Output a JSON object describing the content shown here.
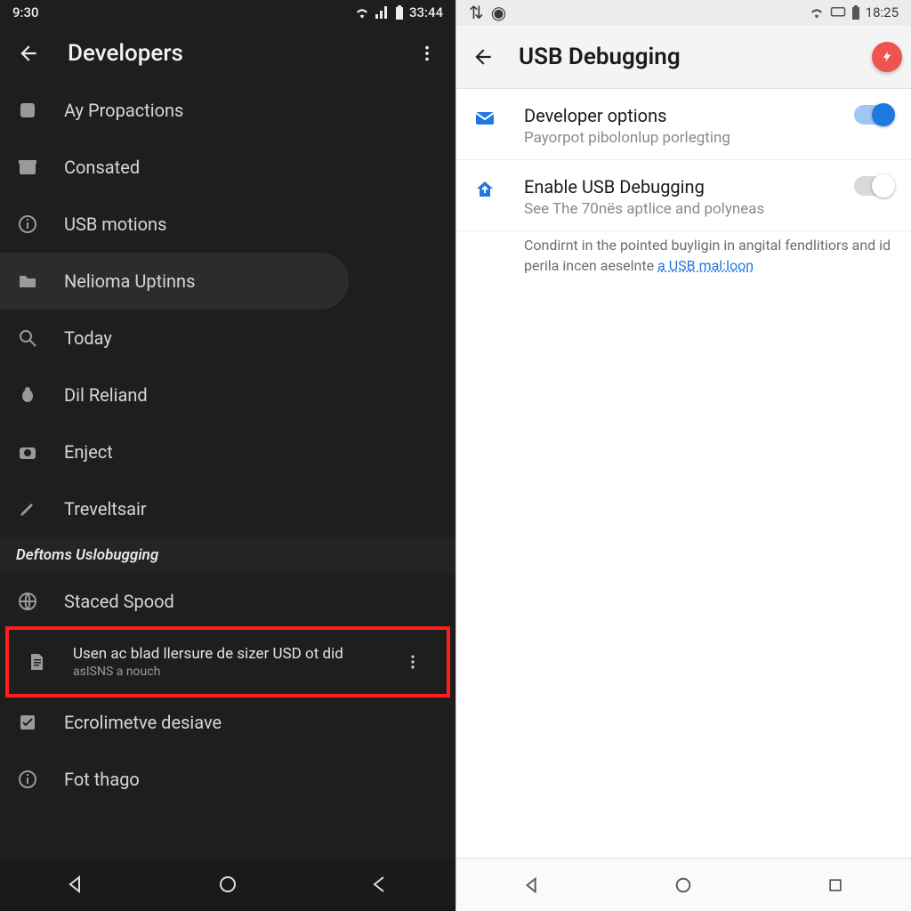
{
  "left": {
    "status": {
      "time": "9:30",
      "extra": "33:44"
    },
    "appbar": {
      "title": "Developers"
    },
    "items_top": [
      {
        "icon": "square-icon",
        "label": "Ay Propactions"
      },
      {
        "icon": "archive-icon",
        "label": "Consated"
      },
      {
        "icon": "info-icon",
        "label": "USB motions"
      },
      {
        "icon": "folder-icon",
        "label": "Nelioma Uptinns",
        "selected": true
      },
      {
        "icon": "search-icon",
        "label": "Today"
      },
      {
        "icon": "bug-icon",
        "label": "Dil Reliand"
      },
      {
        "icon": "camera-icon",
        "label": "Enject"
      },
      {
        "icon": "edit-icon",
        "label": "Treveltsair"
      }
    ],
    "section_header": "Deftoms Uslobugging",
    "items_bottom": [
      {
        "icon": "globe-icon",
        "label": "Staced Spood"
      },
      {
        "icon": "document-icon",
        "label": "Usen ac blad llersure de sizer USD ot did",
        "sub": "asISNS a nouch",
        "highlighted": true,
        "trailing_overflow": true
      },
      {
        "icon": "checkbox-icon",
        "label": "Ecrolimetve desiave"
      },
      {
        "icon": "info-icon",
        "label": "Fot thago"
      }
    ]
  },
  "right": {
    "status": {
      "time": "18:25"
    },
    "appbar": {
      "title": "USB Debugging"
    },
    "settings": [
      {
        "icon": "mail-icon",
        "title": "Developer options",
        "subtitle": "Payorpot pibolonlup porlegting",
        "switch": "on"
      },
      {
        "icon": "upload-house-icon",
        "title": "Enable USB Debugging",
        "subtitle": "See The 70nës aptlice and polyneas",
        "switch": "off"
      }
    ],
    "helper_pre": "Condirnt in the pointed buyligin in angital fendlitiors and id perila incen aeselnte ",
    "helper_link": "a USB mal:loon"
  },
  "colors": {
    "accent_blue": "#1f78e0",
    "danger_red": "#ef5350",
    "highlight_red": "#ff1d1d"
  }
}
